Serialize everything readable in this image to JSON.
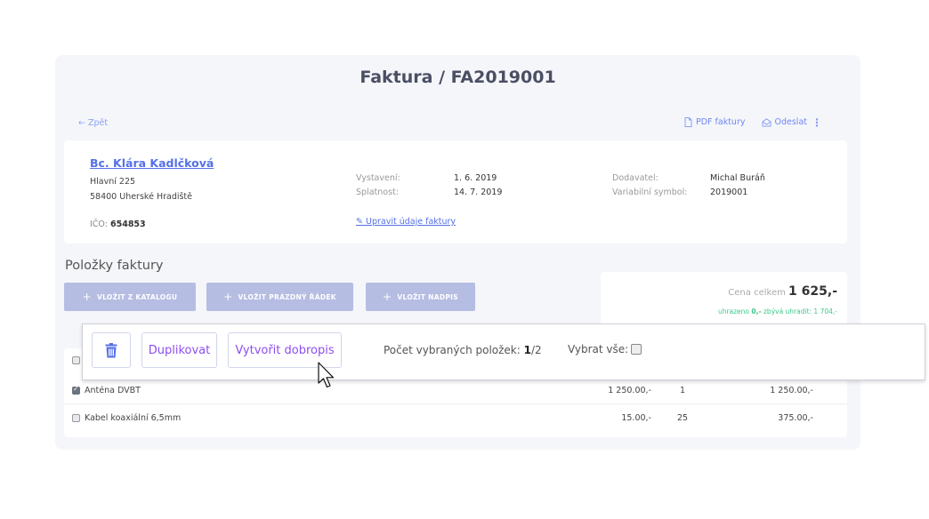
{
  "page": {
    "title": "Faktura / FA2019001",
    "back_label": "Zpět",
    "actions": [
      {
        "label": "PDF faktury",
        "icon": "document-icon"
      },
      {
        "label": "Odeslat",
        "icon": "send-icon"
      }
    ],
    "more_icon": "⋮"
  },
  "customer": {
    "name": "Bc. Klára Kadlčková",
    "street": "Hlavní 225",
    "city": "58400 Uherské Hradiště",
    "ico_label": "IČO:",
    "ico_value": "654853"
  },
  "dates": {
    "issued_label": "Vystavení:",
    "issued_value": "1. 6. 2019",
    "due_label": "Splatnost:",
    "due_value": "14. 7. 2019",
    "edit_link": "Upravit údaje faktury"
  },
  "supplier": {
    "supplier_label": "Dodavatel:",
    "supplier_value": "Michal Buráň",
    "vs_label": "Variabilní symbol:",
    "vs_value": "2019001"
  },
  "items_section": {
    "title": "Položky faktury",
    "insert_buttons": [
      "VLOŽIT Z KATALOGU",
      "VLOŽIT PRÁZDNÝ ŘÁDEK",
      "VLOŽIT NADPIS"
    ]
  },
  "totals": {
    "total_label": "Cena celkem",
    "total_value": "1 625,-",
    "paid_prefix": "uhrazeno",
    "paid_value": "0,-",
    "remaining_text": "zbývá uhradit: 1 704,-"
  },
  "selection_toolbar": {
    "duplicate_label": "Duplikovat",
    "credit_note_label": "Vytvořit dobropis",
    "count_label": "Počet vybraných položek:",
    "count_selected": "1",
    "count_total": "/2",
    "select_all_label": "Vybrat vše:"
  },
  "items": [
    {
      "name": "Anténa DVBT",
      "price": "1 250.00,-",
      "qty": "1",
      "total": "1 250.00,-",
      "checked": true
    },
    {
      "name": "Kabel koaxiální 6,5mm",
      "price": "15.00,-",
      "qty": "25",
      "total": "375.00,-",
      "checked": false
    }
  ],
  "colors": {
    "accent": "#5570e6",
    "toolbar_text": "#8d4df2",
    "insert_button_bg": "#b6bde2",
    "paid_green": "#3cc88c"
  }
}
